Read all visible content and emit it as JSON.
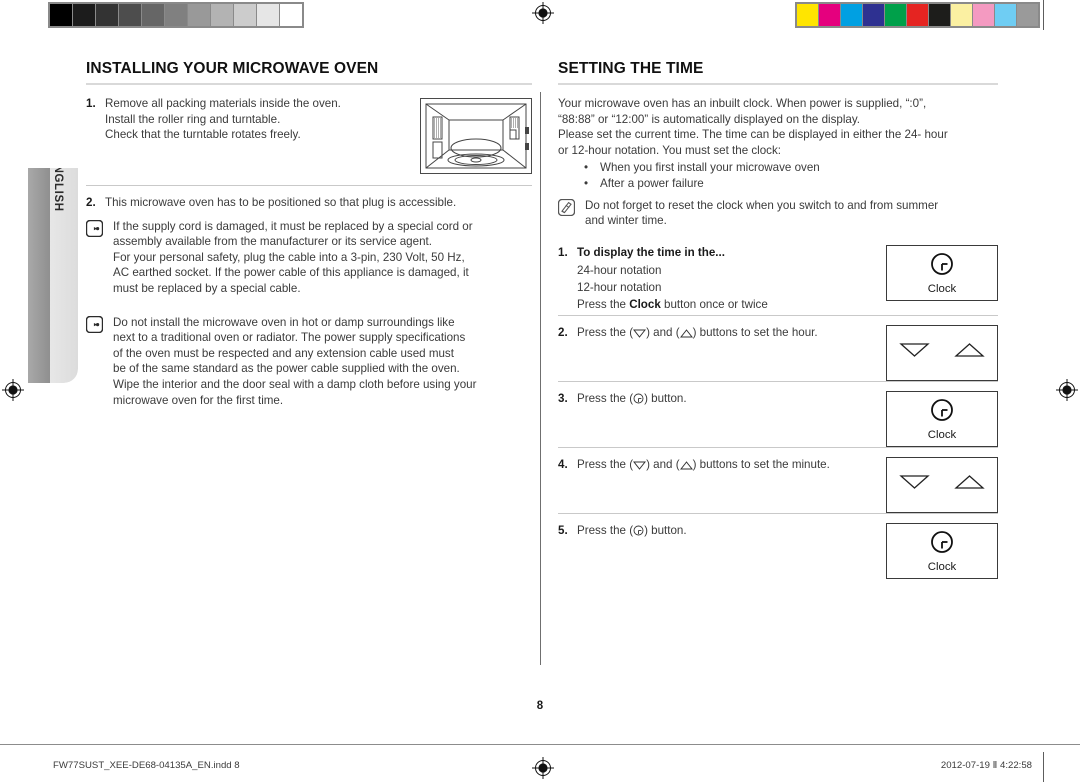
{
  "document": {
    "page_number": "8",
    "language_tab": "ENGLISH",
    "footer_left": "FW77SUST_XEE-DE68-04135A_EN.indd   8",
    "footer_right": "2012-07-19   Ⅱ 4:22:58"
  },
  "calibration": {
    "grayscale_label": "grayscale-calibration-strip",
    "grayscale_swatches": [
      "#000000",
      "#1c1c1c",
      "#333333",
      "#4d4d4d",
      "#666666",
      "#808080",
      "#999999",
      "#b3b3b3",
      "#cccccc",
      "#e6e6e6",
      "#ffffff"
    ],
    "color_label": "color-calibration-strip",
    "color_swatches": [
      "#ffe500",
      "#e5007e",
      "#00a0e2",
      "#2e3191",
      "#00a04a",
      "#e52421",
      "#1d1d1b",
      "#fbf0a2",
      "#f49ac1",
      "#6fcdf3",
      "#9a9a9a"
    ]
  },
  "left_column": {
    "title": "INSTALLING YOUR MICROWAVE OVEN",
    "step1": {
      "number": "1.",
      "lines": [
        "Remove all packing materials inside the oven.",
        "Install the roller ring and turntable.",
        "Check that the turntable rotates freely."
      ],
      "figure_name": "microwave-oven-interior-illustration"
    },
    "step2": {
      "number": "2.",
      "text": "This microwave oven has to be positioned so that plug is accessible."
    },
    "note1": {
      "icon": "pointing-hand-icon",
      "lines": [
        "If the supply cord is damaged, it must be replaced by a special cord or",
        "assembly available from the manufacturer or its service agent.",
        "For your personal safety, plug the cable into a 3-pin, 230 Volt, 50 Hz,",
        "AC earthed socket. If the power cable of this appliance is damaged, it",
        "must be replaced by a special cable."
      ]
    },
    "note2": {
      "icon": "pointing-hand-icon",
      "lines": [
        "Do not install the microwave oven in hot or damp surroundings like",
        "next to a traditional oven or radiator. The power supply specifications",
        "of the oven must be respected and any extension cable used must",
        "be of the same standard as the power cable supplied with the oven.",
        "Wipe the interior and the door seal with a damp cloth before using your",
        "microwave oven for the first time."
      ]
    }
  },
  "right_column": {
    "title": "SETTING THE TIME",
    "intro_lines": [
      "Your microwave oven has an inbuilt clock. When power is supplied, “:0”,",
      "“88:88” or “12:00” is automatically displayed on the display.",
      "Please set the current time. The time can be displayed in either the 24- hour",
      "or 12-hour notation. You must set the clock:"
    ],
    "bullets": [
      "When you first install your microwave oven",
      "After a power failure"
    ],
    "note": {
      "icon": "note-pencil-icon",
      "lines": [
        "Do not forget to reset the clock when you switch to and from summer",
        "and winter time."
      ]
    },
    "steps": [
      {
        "number": "1.",
        "heading": "To display the time in the...",
        "sub_lines": [
          "24-hour notation",
          "12-hour notation"
        ],
        "press_prefix": "Press the ",
        "press_bold": "Clock",
        "press_suffix": " button once or twice",
        "button": {
          "type": "clock",
          "caption": "Clock",
          "icon": "clock-icon"
        }
      },
      {
        "number": "2.",
        "text_before": "Press the (",
        "text_mid": ") and (",
        "text_after": ") buttons to set the hour.",
        "button": {
          "type": "arrows",
          "icons": [
            "arrow-down-icon",
            "arrow-up-icon"
          ]
        }
      },
      {
        "number": "3.",
        "text_before": "Press the (",
        "text_after": ") button.",
        "button": {
          "type": "clock",
          "caption": "Clock",
          "icon": "clock-icon"
        }
      },
      {
        "number": "4.",
        "text_before": "Press the (",
        "text_mid": ") and (",
        "text_after": ") buttons to set the minute.",
        "button": {
          "type": "arrows",
          "icons": [
            "arrow-down-icon",
            "arrow-up-icon"
          ]
        }
      },
      {
        "number": "5.",
        "text_before": "Press the (",
        "text_after": ") button.",
        "button": {
          "type": "clock",
          "caption": "Clock",
          "icon": "clock-icon"
        }
      }
    ]
  }
}
